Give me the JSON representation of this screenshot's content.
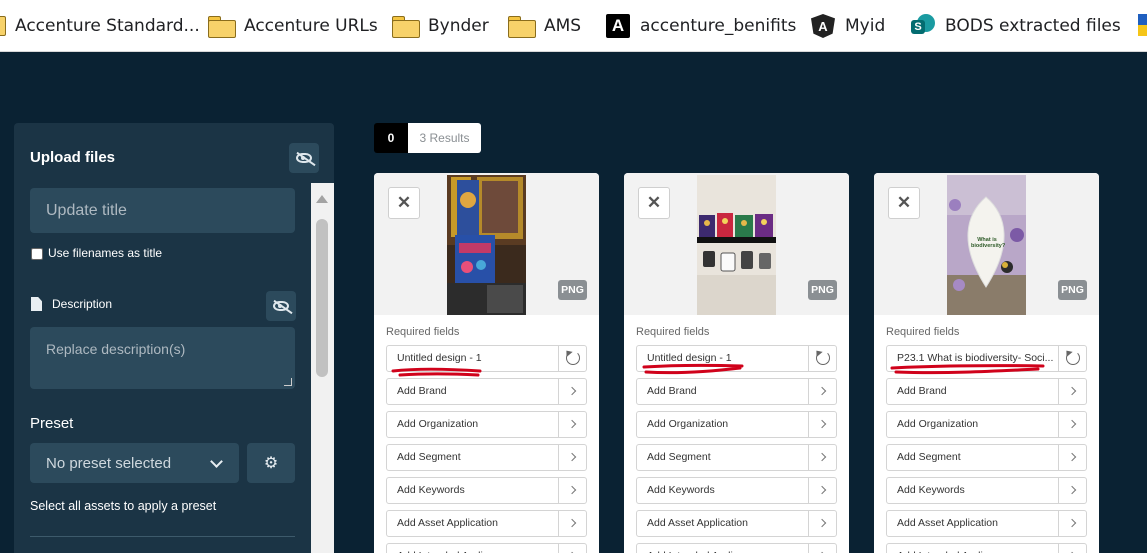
{
  "bookmarks": [
    {
      "label": "Accenture Standard...",
      "icon": "folder-icon"
    },
    {
      "label": "Accenture URLs",
      "icon": "folder-icon"
    },
    {
      "label": "Bynder",
      "icon": "folder-icon"
    },
    {
      "label": "AMS",
      "icon": "folder-icon"
    },
    {
      "label": "accenture_benifits",
      "icon": "accenture-logo-icon"
    },
    {
      "label": "Myid",
      "icon": "angular-icon"
    },
    {
      "label": "BODS extracted files",
      "icon": "sharepoint-icon"
    }
  ],
  "upload_panel": {
    "title": "Upload files",
    "title_placeholder": "Update title",
    "use_filenames_label": "Use filenames as title",
    "description_label": "Description",
    "description_placeholder": "Replace description(s)",
    "preset_label": "Preset",
    "preset_value": "No preset selected",
    "hint": "Select all assets to apply a preset"
  },
  "results": {
    "selected_count": "0",
    "label": "3 Results"
  },
  "cards": [
    {
      "format": "PNG",
      "required_label": "Required fields",
      "title": "Untitled design - 1",
      "fields": [
        "Add Brand",
        "Add Organization",
        "Add Segment",
        "Add Keywords",
        "Add Asset Application",
        "Add Intended Audience"
      ]
    },
    {
      "format": "PNG",
      "required_label": "Required fields",
      "title": "Untitled design - 1",
      "fields": [
        "Add Brand",
        "Add Organization",
        "Add Segment",
        "Add Keywords",
        "Add Asset Application",
        "Add Intended Audience"
      ]
    },
    {
      "format": "PNG",
      "required_label": "Required fields",
      "title": "P23.1 What is biodiversity- Soci...",
      "image_text": "What is biodiversity?",
      "fields": [
        "Add Brand",
        "Add Organization",
        "Add Segment",
        "Add Keywords",
        "Add Asset Application",
        "Add Intended Audience"
      ]
    }
  ],
  "colors": {
    "background": "#0a2233",
    "panel": "#1b3445",
    "input": "#2c4a5c",
    "annotation": "#d0021b"
  }
}
